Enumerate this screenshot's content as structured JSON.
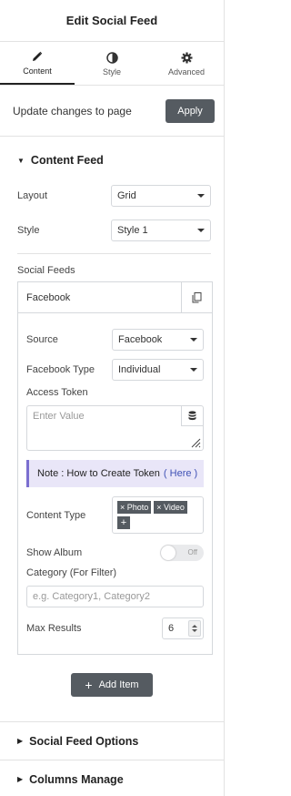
{
  "header": {
    "title": "Edit Social Feed"
  },
  "tabs": [
    {
      "label": "Content",
      "icon": "pencil-icon"
    },
    {
      "label": "Style",
      "icon": "contrast-icon"
    },
    {
      "label": "Advanced",
      "icon": "gear-icon"
    }
  ],
  "update": {
    "text": "Update changes to page",
    "button": "Apply"
  },
  "content_feed": {
    "title": "Content Feed",
    "layout": {
      "label": "Layout",
      "value": "Grid"
    },
    "style": {
      "label": "Style",
      "value": "Style 1"
    },
    "social_feeds_label": "Social Feeds"
  },
  "repeater": {
    "item_title": "Facebook",
    "source": {
      "label": "Source",
      "value": "Facebook"
    },
    "facebook_type": {
      "label": "Facebook Type",
      "value": "Individual"
    },
    "access_token": {
      "label": "Access Token",
      "placeholder": "Enter Value"
    },
    "note": {
      "text": "Note : How to Create Token",
      "link": "( Here )"
    },
    "content_type": {
      "label": "Content Type",
      "tags": [
        "× Photo",
        "× Video"
      ],
      "add": "+"
    },
    "show_album": {
      "label": "Show Album",
      "toggle_text": "Off"
    },
    "category": {
      "label": "Category (For Filter)",
      "placeholder": "e.g. Category1, Category2"
    },
    "max_results": {
      "label": "Max Results",
      "value": "6"
    }
  },
  "add_item": {
    "label": "Add Item",
    "icon": "+"
  },
  "sections": {
    "social_feed_options": "Social Feed Options",
    "columns_manage": "Columns Manage"
  },
  "colors": {
    "dark_button": "#555b61",
    "note_bg": "#e9e6f8",
    "note_border": "#7b6fd0",
    "link": "#3f51b5"
  }
}
